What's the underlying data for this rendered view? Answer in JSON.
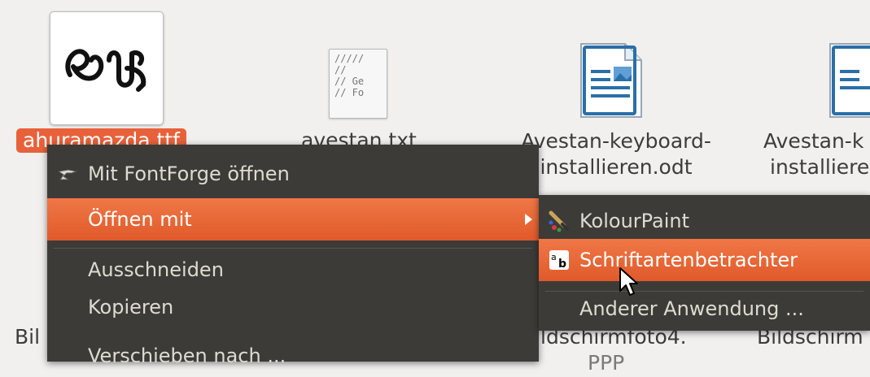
{
  "desktop": {
    "files": [
      {
        "name": "ahuramazda.ttf"
      },
      {
        "name": "avestan.txt"
      },
      {
        "name_line1": "Avestan-keyboard-",
        "name_line2": "installieren.odt"
      },
      {
        "name_line1": "Avestan-k",
        "name_line2": "installiere"
      }
    ],
    "txt_preview": "/////\n//\n// Ge\n// Fo",
    "bottom_labels": [
      "Bil",
      "ldschirmfoto4.",
      "Bildschirm",
      "PPP"
    ]
  },
  "context_menu": {
    "items": [
      {
        "label": "Mit FontForge öffnen",
        "icon": "fontforge-icon"
      },
      {
        "label": "Öffnen mit",
        "highlighted": true,
        "has_submenu": true
      },
      {
        "label": "Ausschneiden"
      },
      {
        "label": "Kopieren"
      },
      {
        "label": "Verschieben nach ..."
      }
    ]
  },
  "submenu": {
    "items": [
      {
        "label": "KolourPaint",
        "icon": "kolourpaint-icon"
      },
      {
        "label": "Schriftartenbetrachter",
        "icon": "font-viewer-icon",
        "highlighted": true
      },
      {
        "label": "Anderer Anwendung ..."
      }
    ]
  },
  "colors": {
    "accent": "#e8613a",
    "menu_bg": "#3c3b37",
    "menu_text": "#dfdbd2"
  }
}
